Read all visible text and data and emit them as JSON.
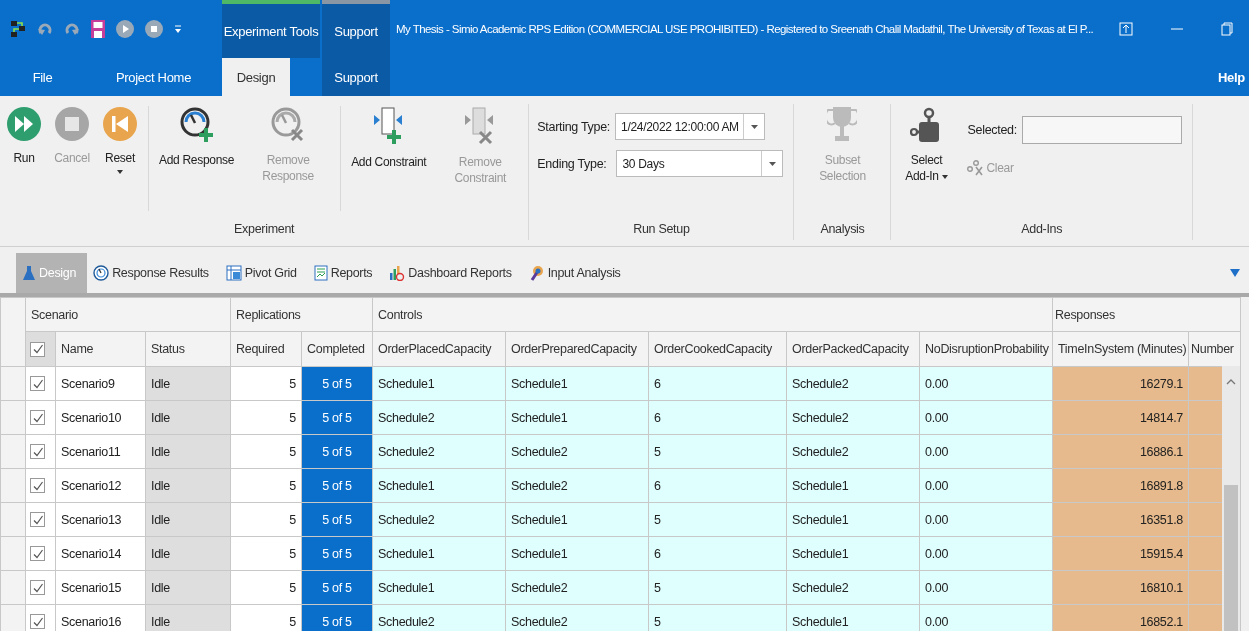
{
  "title_bar": {
    "context_tabs": [
      {
        "label": "Experiment Tools",
        "kind": "experiment"
      },
      {
        "label": "Support",
        "kind": "support"
      }
    ],
    "title": "My Thesis - Simio Academic RPS Edition (COMMERCIAL USE PROHIBITED) - Registered to Sreenath Chalil Madathil, The University of Texas at El P..."
  },
  "menu_tabs": [
    {
      "label": "File",
      "selected": false
    },
    {
      "label": "Project Home",
      "selected": false
    },
    {
      "label": "Design",
      "selected": true
    },
    {
      "label": "Support",
      "selected": false
    }
  ],
  "help": "Help",
  "ribbon": {
    "experiment": {
      "label": "Experiment",
      "buttons": [
        {
          "kind": "run",
          "label": "Run",
          "disabled": false,
          "dropdown": false
        },
        {
          "kind": "cancel",
          "label": "Cancel",
          "disabled": true,
          "dropdown": false
        },
        {
          "kind": "reset",
          "label": "Reset",
          "disabled": false,
          "dropdown": true
        },
        {
          "kind": "add-response",
          "label": "Add Response",
          "disabled": false,
          "dropdown": false
        },
        {
          "kind": "remove-response",
          "label": "Remove Response",
          "disabled": true,
          "dropdown": false
        },
        {
          "kind": "add-constraint",
          "label": "Add Constraint",
          "disabled": false,
          "dropdown": false
        },
        {
          "kind": "remove-constraint",
          "label": "Remove Constraint",
          "disabled": true,
          "dropdown": false
        }
      ]
    },
    "run_setup": {
      "label": "Run Setup",
      "fields": [
        {
          "label": "Starting Type:",
          "value": "1/24/2022 12:00:00 AM"
        },
        {
          "label": "Ending Type:",
          "value": "30 Days"
        }
      ]
    },
    "analysis": {
      "label": "Analysis",
      "button": {
        "label": "Subset Selection",
        "disabled": true
      }
    },
    "add_ins": {
      "label": "Add-Ins",
      "select": {
        "label": "Select Add-In",
        "dropdown": true
      },
      "selected_label": "Selected:",
      "clear": {
        "label": "Clear",
        "disabled": true
      }
    }
  },
  "view_tabs": [
    {
      "label": "Design",
      "selected": true
    },
    {
      "label": "Response Results",
      "selected": false
    },
    {
      "label": "Pivot Grid",
      "selected": false
    },
    {
      "label": "Reports",
      "selected": false
    },
    {
      "label": "Dashboard Reports",
      "selected": false
    },
    {
      "label": "Input Analysis",
      "selected": false
    }
  ],
  "table": {
    "groups": [
      "Scenario",
      "Replications",
      "Controls",
      "Responses"
    ],
    "header_checked": true,
    "columns": [
      "Name",
      "Status",
      "Required",
      "Completed",
      "OrderPlacedCapacity",
      "OrderPreparedCapacity",
      "OrderCookedCapacity",
      "OrderPackedCapacity",
      "NoDisruptionProbability",
      "TimeInSystem (Minutes)",
      "Number"
    ],
    "rows": [
      {
        "checked": true,
        "cells": [
          "Scenario9",
          "Idle",
          "5",
          "5 of 5",
          "Schedule1",
          "Schedule1",
          "6",
          "Schedule2",
          "0.00",
          "16279.1"
        ]
      },
      {
        "checked": true,
        "cells": [
          "Scenario10",
          "Idle",
          "5",
          "5 of 5",
          "Schedule2",
          "Schedule1",
          "6",
          "Schedule2",
          "0.00",
          "14814.7"
        ]
      },
      {
        "checked": true,
        "cells": [
          "Scenario11",
          "Idle",
          "5",
          "5 of 5",
          "Schedule2",
          "Schedule2",
          "5",
          "Schedule2",
          "0.00",
          "16886.1"
        ]
      },
      {
        "checked": true,
        "cells": [
          "Scenario12",
          "Idle",
          "5",
          "5 of 5",
          "Schedule1",
          "Schedule2",
          "6",
          "Schedule1",
          "0.00",
          "16891.8"
        ]
      },
      {
        "checked": true,
        "cells": [
          "Scenario13",
          "Idle",
          "5",
          "5 of 5",
          "Schedule2",
          "Schedule1",
          "5",
          "Schedule1",
          "0.00",
          "16351.8"
        ]
      },
      {
        "checked": true,
        "cells": [
          "Scenario14",
          "Idle",
          "5",
          "5 of 5",
          "Schedule1",
          "Schedule1",
          "6",
          "Schedule1",
          "0.00",
          "15915.4"
        ]
      },
      {
        "checked": true,
        "cells": [
          "Scenario15",
          "Idle",
          "5",
          "5 of 5",
          "Schedule1",
          "Schedule2",
          "5",
          "Schedule2",
          "0.00",
          "16810.1"
        ]
      },
      {
        "checked": true,
        "cells": [
          "Scenario16",
          "Idle",
          "5",
          "5 of 5",
          "Schedule2",
          "Schedule2",
          "5",
          "Schedule1",
          "0.00",
          "16852.1"
        ]
      }
    ]
  }
}
